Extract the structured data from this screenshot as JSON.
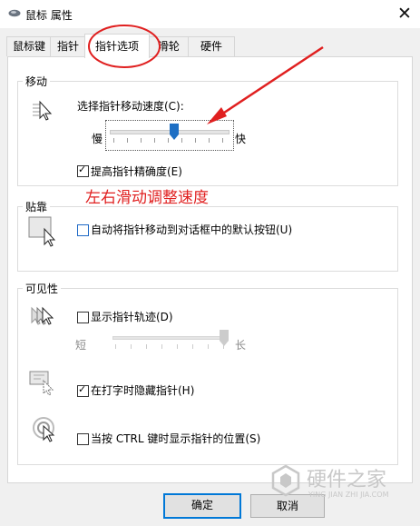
{
  "window": {
    "title": "鼠标 属性",
    "close_glyph": "✕"
  },
  "tabs": [
    {
      "label": "鼠标键",
      "active": false
    },
    {
      "label": "指针",
      "active": false
    },
    {
      "label": "指针选项",
      "active": true
    },
    {
      "label": "滑轮",
      "active": false
    },
    {
      "label": "硬件",
      "active": false
    }
  ],
  "motion": {
    "group_label": "移动",
    "speed_label": "选择指针移动速度(C):",
    "slow_label": "慢",
    "fast_label": "快",
    "speed_value": 0.55,
    "precision_label": "提高指针精确度(E)",
    "precision_checked": true
  },
  "annotation": {
    "text": "左右滑动调整速度",
    "color": "#e02020"
  },
  "snap": {
    "group_label": "贴靠",
    "snap_label": "自动将指针移动到对话框中的默认按钮(U)",
    "snap_checked": false
  },
  "visibility": {
    "group_label": "可见性",
    "trails_label": "显示指针轨迹(D)",
    "trails_checked": false,
    "short_label": "短",
    "long_label": "长",
    "trail_length_value": 1.0,
    "hide_label": "在打字时隐藏指针(H)",
    "hide_checked": true,
    "ctrl_label": "当按 CTRL 键时显示指针的位置(S)",
    "ctrl_checked": false
  },
  "buttons": {
    "ok": "确定",
    "cancel": "取消"
  },
  "watermark": {
    "brand": "硬件之家",
    "url": "YING JIAN ZHI JIA.COM"
  },
  "colors": {
    "accent": "#0078d7",
    "slider_thumb": "#1e6fc4",
    "highlight_red": "#e02020"
  },
  "icons": [
    "mouse-icon",
    "close-icon",
    "pointer-speed-icon",
    "snap-to-icon",
    "pointer-trails-icon",
    "hide-pointer-icon",
    "ctrl-locate-icon"
  ]
}
